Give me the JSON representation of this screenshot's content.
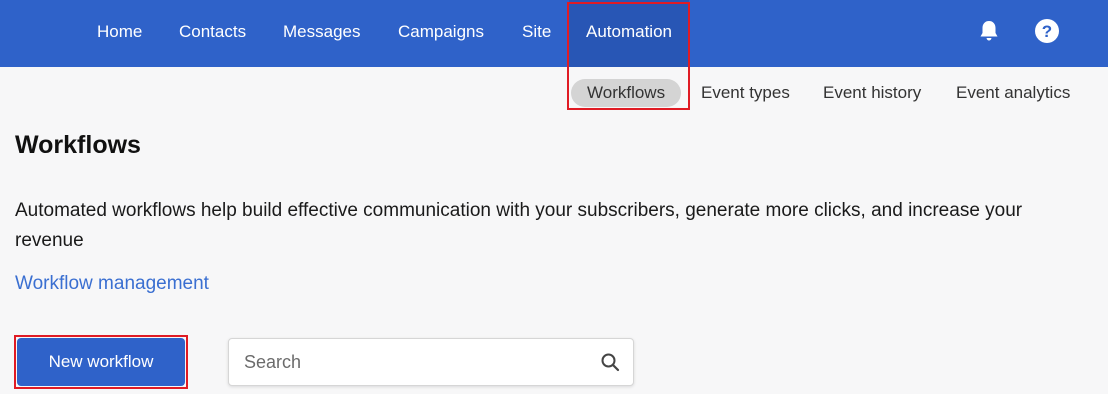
{
  "nav": {
    "items": [
      {
        "label": "Home"
      },
      {
        "label": "Contacts"
      },
      {
        "label": "Messages"
      },
      {
        "label": "Campaigns"
      },
      {
        "label": "Site"
      },
      {
        "label": "Automation",
        "active": true
      }
    ],
    "icons": [
      "bell-icon",
      "help-icon"
    ]
  },
  "subnav": {
    "items": [
      {
        "label": "Workflows",
        "active": true
      },
      {
        "label": "Event types"
      },
      {
        "label": "Event history"
      },
      {
        "label": "Event analytics"
      }
    ]
  },
  "page": {
    "title": "Workflows",
    "description": "Automated workflows help build effective communication with your subscribers, generate more clicks, and increase your revenue",
    "link": "Workflow management"
  },
  "actions": {
    "new_workflow": "New workflow"
  },
  "search": {
    "placeholder": "Search",
    "value": ""
  },
  "colors": {
    "brand": "#2f62c9",
    "link": "#3a6fd1",
    "highlight": "#e01b24"
  }
}
